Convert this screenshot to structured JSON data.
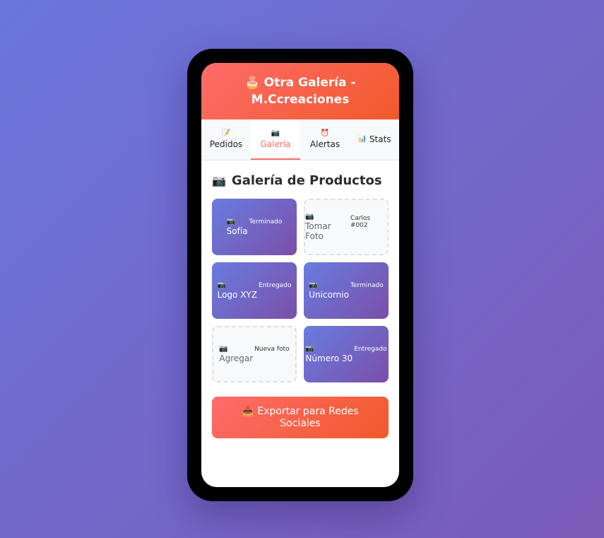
{
  "header": {
    "icon": "🎂",
    "title": "Otra Galería - M.Ccreaciones"
  },
  "tabs": [
    {
      "icon": "📝",
      "label": "Pedidos",
      "active": false
    },
    {
      "icon": "📷",
      "label": "Galería",
      "active": true
    },
    {
      "icon": "⏰",
      "label": "Alertas",
      "active": false
    },
    {
      "icon": "📊",
      "label": "Stats",
      "active": false
    }
  ],
  "gallery": {
    "title_icon": "📷",
    "title": "Galería de Productos",
    "items": [
      {
        "icon": "📷",
        "name": "Sofía",
        "badge": "Terminado",
        "empty": false
      },
      {
        "icon": "📷",
        "name": "Tomar Foto",
        "badge": "Carlos #002",
        "empty": true
      },
      {
        "icon": "📷",
        "name": "Logo XYZ",
        "badge": "Entregado",
        "empty": false
      },
      {
        "icon": "📷",
        "name": "Unicornio",
        "badge": "Terminado",
        "empty": false
      },
      {
        "icon": "📷",
        "name": "Agregar",
        "badge": "Nueva foto",
        "empty": true
      },
      {
        "icon": "📷",
        "name": "Número 30",
        "badge": "Entregado",
        "empty": false
      }
    ]
  },
  "export": {
    "icon": "📤",
    "label": "Exportar para Redes Sociales"
  },
  "colors": {
    "accent": "#ff6b6b",
    "accent_dark": "#f05a2a",
    "card_start": "#6a7ce0",
    "card_end": "#7a4fa8",
    "background": "#6a76dc"
  }
}
